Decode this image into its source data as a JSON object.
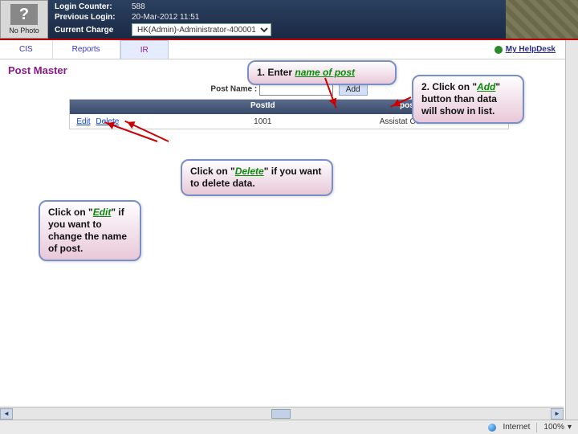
{
  "header": {
    "no_photo": "No Photo",
    "login_counter_label": "Login Counter:",
    "login_counter_value": "588",
    "prev_login_label": "Previous Login:",
    "prev_login_value": "20-Mar-2012 11:51",
    "charge_label": "Current Charge",
    "charge_value": "HK(Admin)-Administrator-400001"
  },
  "tabs": {
    "cis": "CIS",
    "reports": "Reports",
    "ir": "IR",
    "help": "My HelpDesk"
  },
  "page": {
    "title": "Post Master"
  },
  "form": {
    "label": "Post Name :",
    "add": "Add"
  },
  "grid": {
    "h_actions": "",
    "h_postid": "PostId",
    "h_postname": "post Name",
    "row": {
      "edit": "Edit",
      "delete": "Delete",
      "id": "1001",
      "name": "Assistat Commissioner"
    }
  },
  "callouts": {
    "c1a": "1. Enter ",
    "c1b": "name of post",
    "c2a": "2. Click on \"",
    "c2b": "Add",
    "c2c": "\" button than data will show in list.",
    "c3a": "Click on \"",
    "c3b": "Delete",
    "c3c": "\" if you want to delete data.",
    "c4a": "Click on \"",
    "c4b": "Edit",
    "c4c": "\" if you want to change the name of post."
  },
  "status": {
    "net": "Internet",
    "zoom": "100%"
  }
}
